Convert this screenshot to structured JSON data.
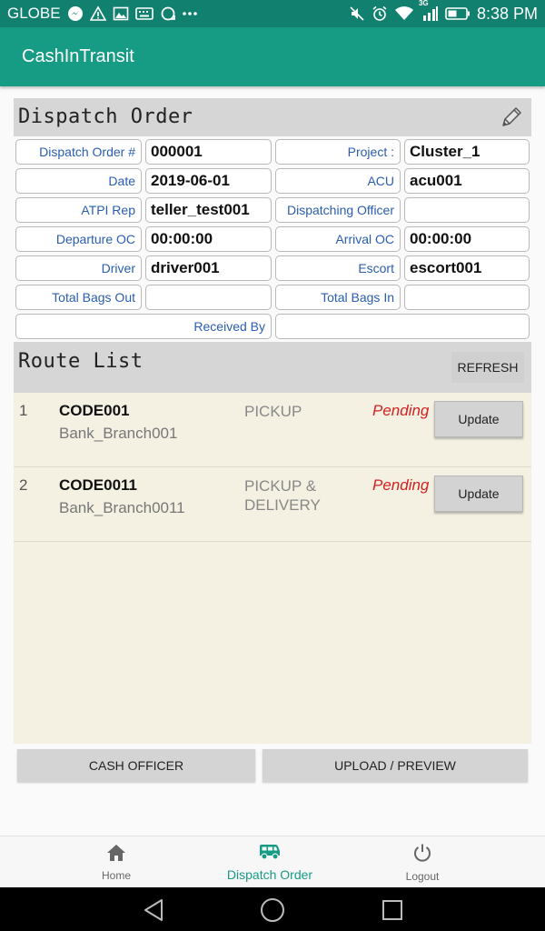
{
  "status_bar": {
    "carrier": "GLOBE",
    "network_type": "3G",
    "time": "8:38 PM",
    "left_icons": [
      "messenger-icon",
      "warning-icon",
      "gallery-icon",
      "keyboard-icon",
      "sync-icon",
      "more-dots-icon"
    ],
    "right_icons": [
      "mute-icon",
      "alarm-icon",
      "wifi-icon",
      "signal-icon",
      "battery-icon"
    ]
  },
  "app_bar": {
    "title": "CashInTransit"
  },
  "dispatch_order": {
    "title": "Dispatch Order",
    "fields": [
      {
        "label": "Dispatch Order #",
        "value": "000001"
      },
      {
        "label": "Project :",
        "value": "Cluster_1"
      },
      {
        "label": "Date",
        "value": "2019-06-01"
      },
      {
        "label": "ACU",
        "value": "acu001"
      },
      {
        "label": "ATPI Rep",
        "value": "teller_test001"
      },
      {
        "label": "Dispatching Officer",
        "value": ""
      },
      {
        "label": "Departure OC",
        "value": "00:00:00"
      },
      {
        "label": "Arrival OC",
        "value": "00:00:00"
      },
      {
        "label": "Driver",
        "value": "driver001"
      },
      {
        "label": "Escort",
        "value": "escort001"
      },
      {
        "label": "Total Bags Out",
        "value": ""
      },
      {
        "label": "Total Bags In",
        "value": ""
      },
      {
        "label": "Received By",
        "value": ""
      }
    ]
  },
  "route_list": {
    "title": "Route List",
    "refresh_label": "REFRESH",
    "rows": [
      {
        "index": "1",
        "code": "CODE001",
        "branch": "Bank_Branch001",
        "type": "PICKUP",
        "status": "Pending",
        "update_label": "Update"
      },
      {
        "index": "2",
        "code": "CODE0011",
        "branch": "Bank_Branch0011",
        "type": "PICKUP & DELIVERY",
        "status": "Pending",
        "update_label": "Update"
      }
    ]
  },
  "actions": {
    "cash_officer": "CASH OFFICER",
    "upload_preview": "UPLOAD / PREVIEW"
  },
  "bottom_nav": {
    "items": [
      {
        "label": "Home",
        "icon": "home-icon"
      },
      {
        "label": "Dispatch Order",
        "icon": "van-icon",
        "active": true
      },
      {
        "label": "Logout",
        "icon": "power-icon"
      }
    ]
  },
  "colors": {
    "primary": "#169b85",
    "status_bar": "#12806f",
    "label_blue": "#2a5db0",
    "pending_red": "#d42020",
    "route_background": "#f4f1e3"
  }
}
